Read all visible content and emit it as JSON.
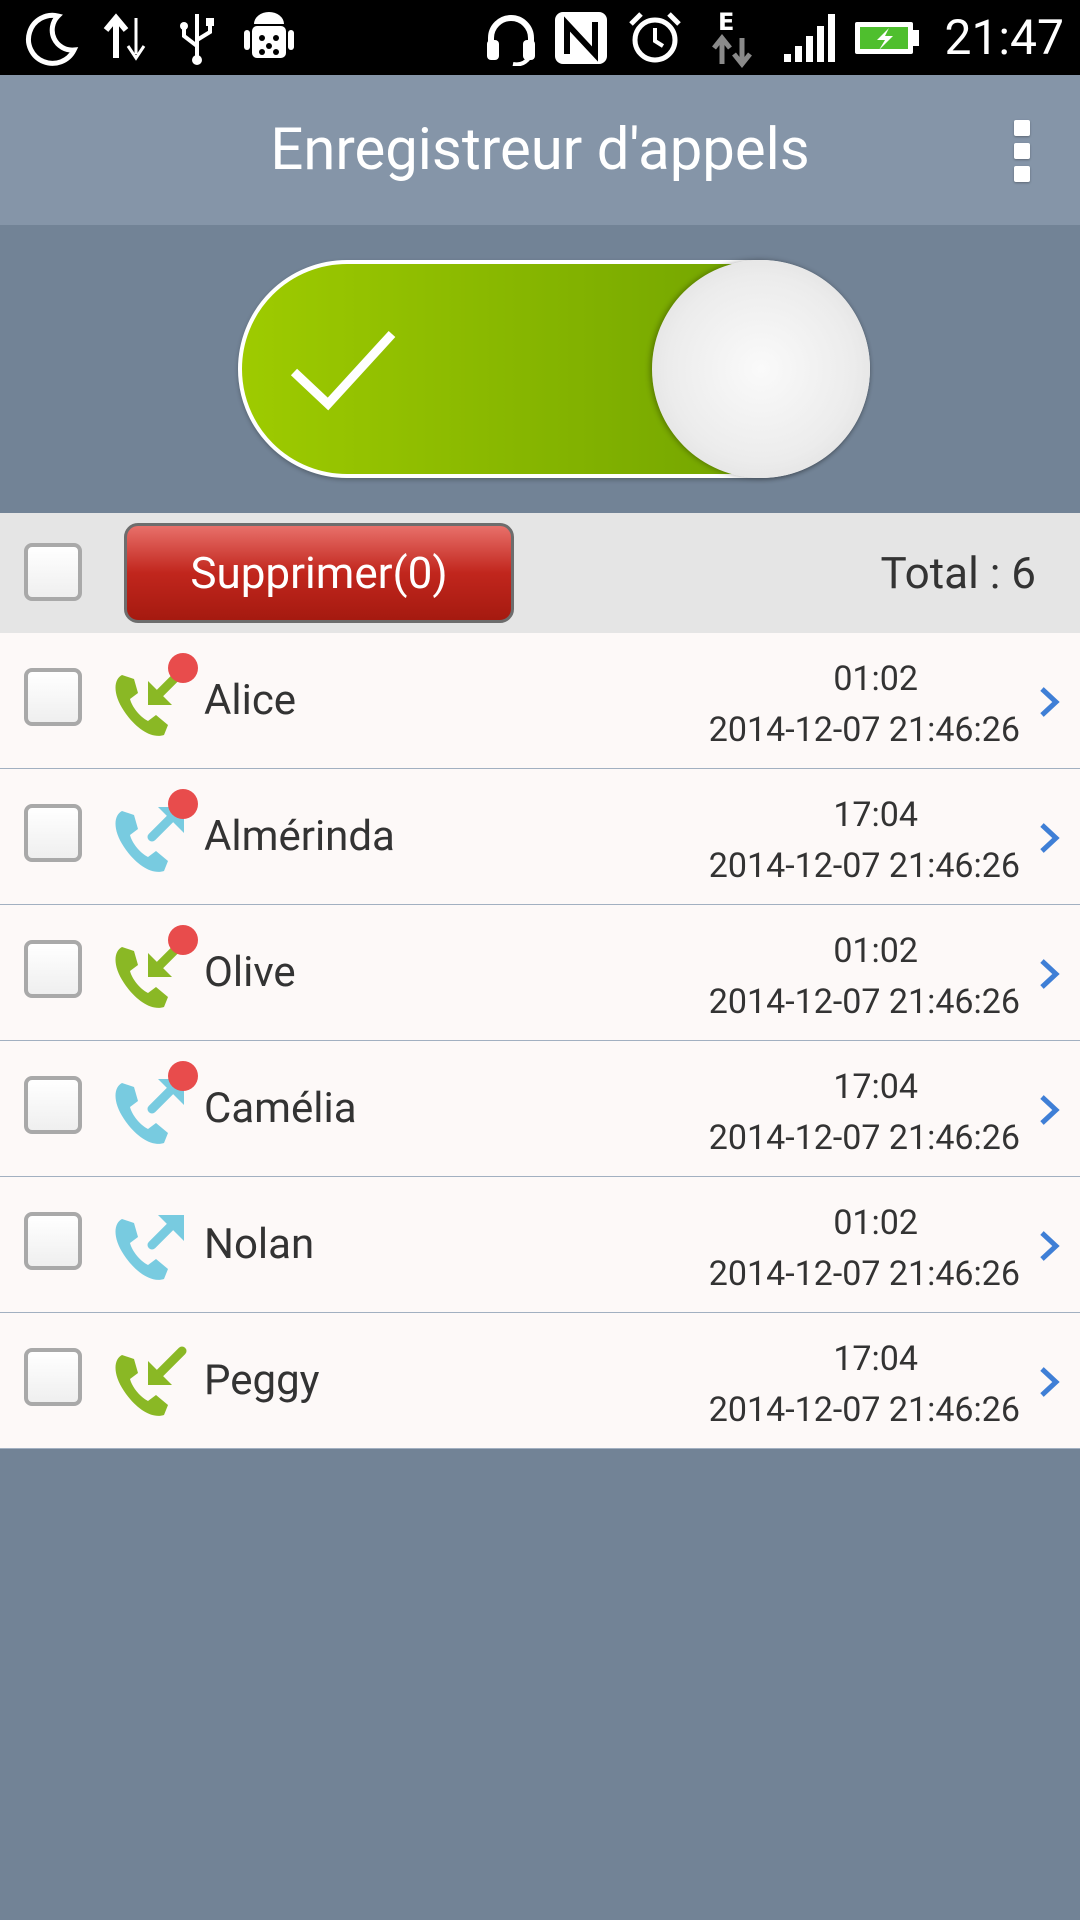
{
  "status_bar": {
    "time": "21:47",
    "icons": [
      "moon-icon",
      "data-transfer-icon",
      "usb-icon",
      "android-debug-icon",
      "headset-icon",
      "nfc-icon",
      "alarm-icon",
      "edge-network-icon",
      "signal-icon",
      "battery-charging-icon"
    ]
  },
  "app_bar": {
    "title": "Enregistreur d'appels",
    "menu_icon": "overflow-menu-icon"
  },
  "recording_toggle": {
    "state": "on"
  },
  "action_bar": {
    "delete_label": "Supprimer(0)",
    "total_label": "Total : 6"
  },
  "colors": {
    "incoming": "#8ab825",
    "outgoing": "#78cbe0",
    "new_badge": "#e84c4c"
  },
  "calls": [
    {
      "name": "Alice",
      "duration": "01:02",
      "datetime": "2014-12-07 21:46:26",
      "direction": "incoming",
      "new": true
    },
    {
      "name": "Almérinda",
      "duration": "17:04",
      "datetime": "2014-12-07 21:46:26",
      "direction": "outgoing",
      "new": true
    },
    {
      "name": "Olive",
      "duration": "01:02",
      "datetime": "2014-12-07 21:46:26",
      "direction": "incoming",
      "new": true
    },
    {
      "name": "Camélia",
      "duration": "17:04",
      "datetime": "2014-12-07 21:46:26",
      "direction": "outgoing",
      "new": true
    },
    {
      "name": "Nolan",
      "duration": "01:02",
      "datetime": "2014-12-07 21:46:26",
      "direction": "outgoing",
      "new": false
    },
    {
      "name": "Peggy",
      "duration": "17:04",
      "datetime": "2014-12-07 21:46:26",
      "direction": "incoming",
      "new": false
    }
  ]
}
